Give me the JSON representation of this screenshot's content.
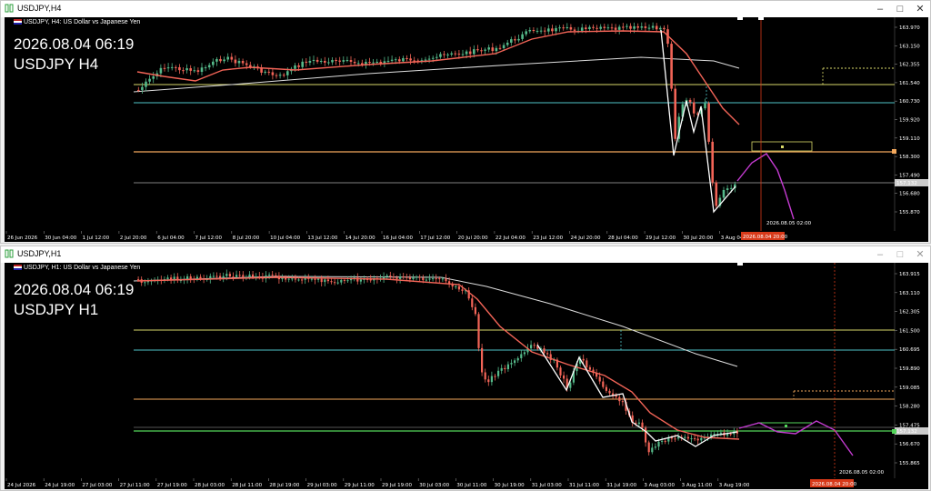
{
  "top": {
    "window_title": "USDJPY,H4",
    "info": "USDJPY, H4:  US Dollar vs Japanese Yen",
    "overlay_line1": "2026.08.04 06:19",
    "overlay_line2": "USDJPY H4",
    "price_labels": [
      "163.970",
      "163.150",
      "162.355",
      "161.540",
      "160.730",
      "159.920",
      "159.110",
      "158.300",
      "157.490",
      "156.680",
      "155.870"
    ],
    "current_price": "157.132",
    "time_labels": [
      "26 Jun 2026",
      "30 Jun 04:00",
      "1 Jul 12:00",
      "2 Jul 20:00",
      "6 Jul 04:00",
      "7 Jul 12:00",
      "8 Jul 20:00",
      "10 Jul 04:00",
      "13 Jul 12:00",
      "14 Jul 20:00",
      "16 Jul 04:00",
      "17 Jul 12:00",
      "20 Jul 20:00",
      "22 Jul 04:00",
      "23 Jul 12:00",
      "24 Jul 20:00",
      "28 Jul 04:00",
      "29 Jul 12:00",
      "30 Jul 20:00",
      "3 Aug 04:00"
    ],
    "vline_label": "2026.08.05 02:00",
    "vline_time_box": "2026.08.04 20:00"
  },
  "bottom": {
    "window_title": "USDJPY,H1",
    "info": "USDJPY, H1:  US Dollar vs Japanese Yen",
    "overlay_line1": "2026.08.04 06:19",
    "overlay_line2": "USDJPY H1",
    "price_labels": [
      "163.915",
      "163.110",
      "162.305",
      "161.500",
      "160.695",
      "159.890",
      "159.085",
      "158.280",
      "157.475",
      "156.670",
      "155.865"
    ],
    "current_price": "157.132",
    "time_labels": [
      "24 Jul 2026",
      "24 Jul 19:00",
      "27 Jul 03:00",
      "27 Jul 11:00",
      "27 Jul 19:00",
      "28 Jul 03:00",
      "28 Jul 11:00",
      "28 Jul 19:00",
      "29 Jul 03:00",
      "29 Jul 11:00",
      "29 Jul 19:00",
      "30 Jul 03:00",
      "30 Jul 11:00",
      "30 Jul 19:00",
      "31 Jul 03:00",
      "31 Jul 11:00",
      "31 Jul 19:00",
      "3 Aug 03:00",
      "3 Aug 11:00",
      "3 Aug 19:00"
    ],
    "vline_label": "2026.08.05 02:00",
    "vline_time_box": "2026.08.04 20:00"
  },
  "colors": {
    "bull": "#55b98a",
    "bear": "#f26457",
    "ma_fast": "#f26457",
    "ma_slow": "#dddddd",
    "zigzag": "#ffffff",
    "projection": "#c43bd1",
    "vline": "#d83a1a",
    "level_orange": "#f3a85c",
    "level_yellow": "#d9d96a",
    "level_cyan": "#4fc3c9",
    "level_green": "#53d65a"
  }
}
